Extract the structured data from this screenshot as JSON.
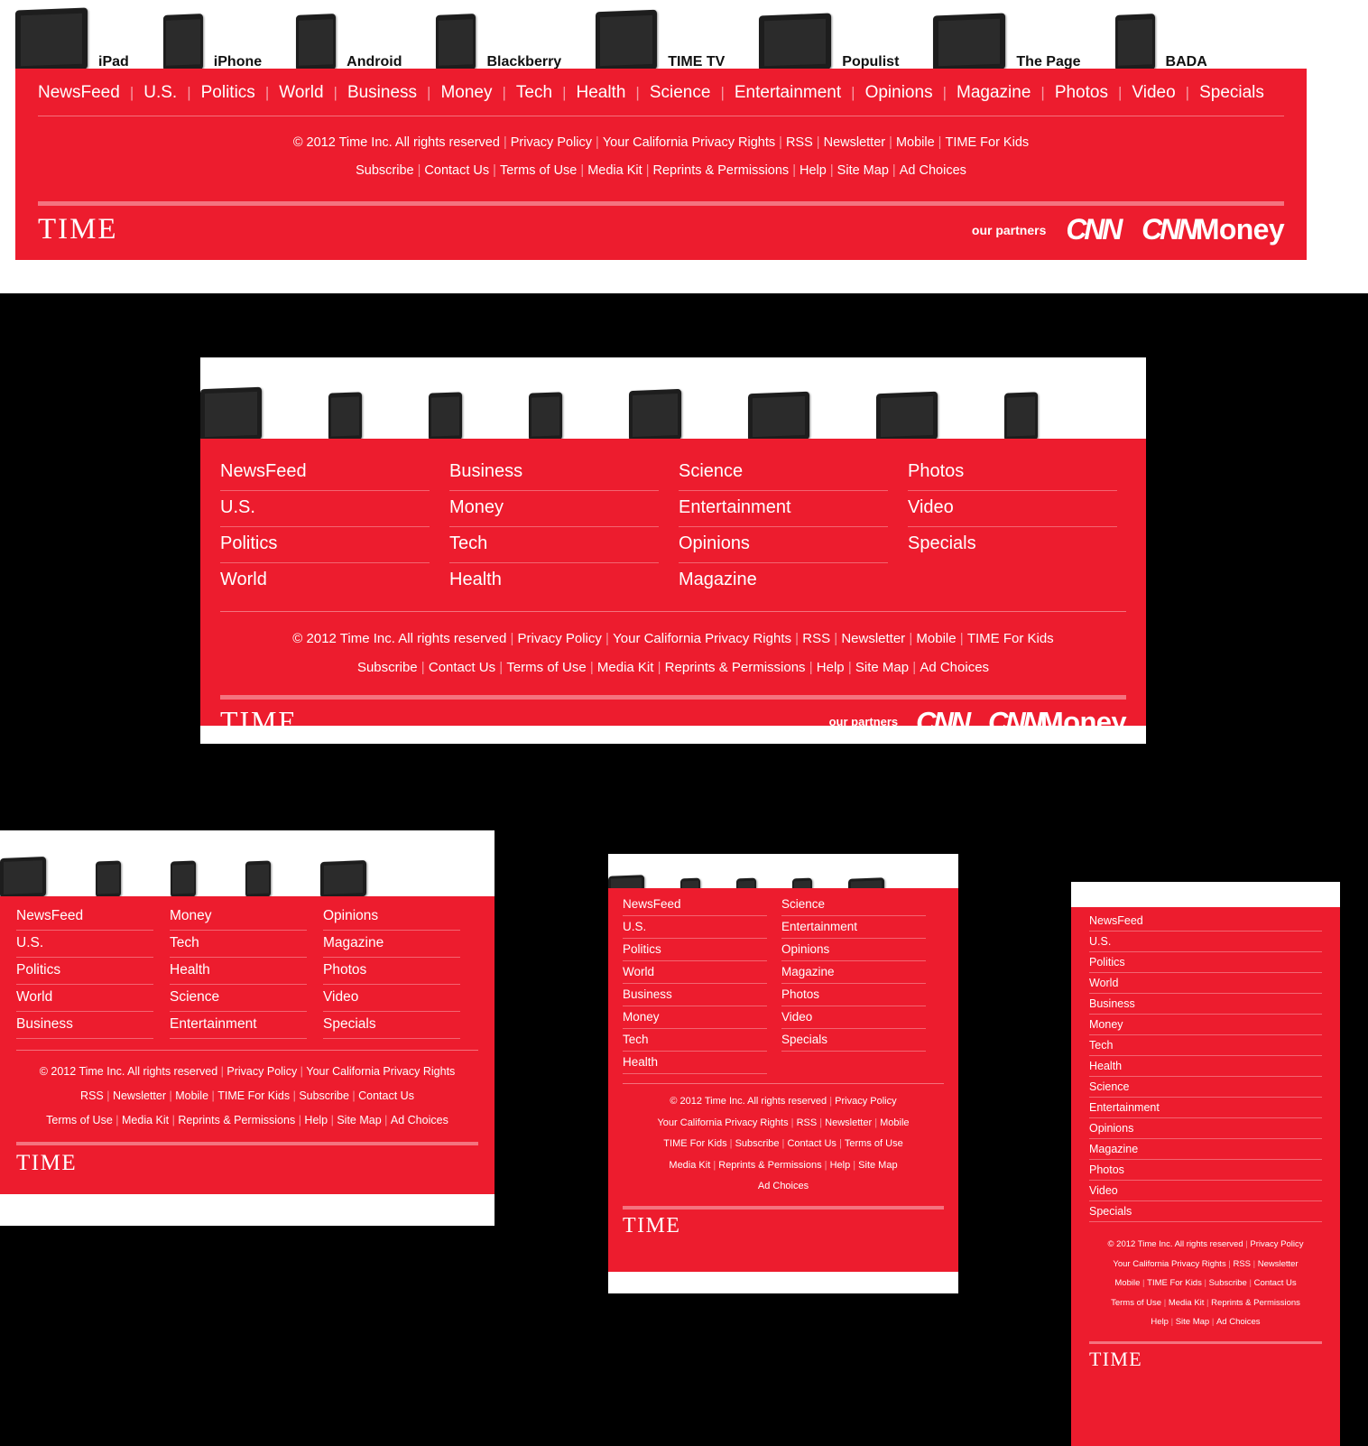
{
  "brand": {
    "logo_text": "TIME",
    "our_partners_label": "our partners",
    "partners": [
      {
        "name": "cnn-logo",
        "text": "CNN"
      },
      {
        "name": "cnnmoney-logo",
        "text_mark": "CNN",
        "text_word": "Money"
      }
    ]
  },
  "colors": {
    "brand_red": "#ED1C2E",
    "rule_pink": "#F4737F",
    "separator": "#F59AA2",
    "page_background": "#000000",
    "panel_background": "#FFFFFF"
  },
  "devices": [
    {
      "label": "iPad",
      "icon": "tablet-ipad-icon"
    },
    {
      "label": "iPhone",
      "icon": "phone-iphone-icon"
    },
    {
      "label": "Android",
      "icon": "phone-android-icon"
    },
    {
      "label": "Blackberry",
      "icon": "phone-blackberry-icon"
    },
    {
      "label": "TIME TV",
      "icon": "tablet-timetv-icon"
    },
    {
      "label": "Populist",
      "icon": "tablet-populist-icon"
    },
    {
      "label": "The Page",
      "icon": "tablet-thepage-icon"
    },
    {
      "label": "BADA",
      "icon": "phone-bada-icon"
    }
  ],
  "sections": [
    "NewsFeed",
    "U.S.",
    "Politics",
    "World",
    "Business",
    "Money",
    "Tech",
    "Health",
    "Science",
    "Entertainment",
    "Opinions",
    "Magazine",
    "Photos",
    "Video",
    "Specials"
  ],
  "legal": {
    "copyright": "© 2012 Time Inc. All rights reserved",
    "links": [
      "Privacy Policy",
      "Your California Privacy Rights",
      "RSS",
      "Newsletter",
      "Mobile",
      "TIME For Kids",
      "Subscribe",
      "Contact Us",
      "Terms of Use",
      "Media Kit",
      "Reprints & Permissions",
      "Help",
      "Site Map",
      "Ad Choices"
    ],
    "separator": "|"
  },
  "panels": [
    {
      "name": "desktop-footer",
      "width_label": "full",
      "nav_layout": "single-row",
      "nav_items": [
        "NewsFeed",
        "U.S.",
        "Politics",
        "World",
        "Business",
        "Money",
        "Tech",
        "Health",
        "Science",
        "Entertainment",
        "Opinions",
        "Magazine",
        "Photos",
        "Video",
        "Specials"
      ],
      "devices_shown": [
        "iPad",
        "iPhone",
        "Android",
        "Blackberry",
        "TIME TV",
        "Populist",
        "The Page",
        "BADA"
      ],
      "legal_rows": [
        [
          "© 2012 Time Inc. All rights reserved",
          "Privacy Policy",
          "Your California Privacy Rights",
          "RSS",
          "Newsletter",
          "Mobile",
          "TIME For Kids"
        ],
        [
          "Subscribe",
          "Contact Us",
          "Terms of Use",
          "Media Kit",
          "Reprints & Permissions",
          "Help",
          "Site Map",
          "Ad Choices"
        ]
      ],
      "show_partners": true
    },
    {
      "name": "tablet-landscape-footer",
      "nav_layout": "four-column",
      "columns": [
        [
          "NewsFeed",
          "U.S.",
          "Politics",
          "World"
        ],
        [
          "Business",
          "Money",
          "Tech",
          "Health"
        ],
        [
          "Science",
          "Entertainment",
          "Opinions",
          "Magazine"
        ],
        [
          "Photos",
          "Video",
          "Specials"
        ]
      ],
      "devices_shown": [
        "iPad",
        "iPhone",
        "Android",
        "Blackberry",
        "TIME TV",
        "Populist",
        "The Page",
        "BADA"
      ],
      "legal_rows": [
        [
          "© 2012 Time Inc. All rights reserved",
          "Privacy Policy",
          "Your California Privacy Rights",
          "RSS",
          "Newsletter",
          "Mobile",
          "TIME For Kids"
        ],
        [
          "Subscribe",
          "Contact Us",
          "Terms of Use",
          "Media Kit",
          "Reprints & Permissions",
          "Help",
          "Site Map",
          "Ad Choices"
        ]
      ],
      "show_partners": true
    },
    {
      "name": "tablet-portrait-footer",
      "nav_layout": "three-column",
      "columns": [
        [
          "NewsFeed",
          "U.S.",
          "Politics",
          "World",
          "Business"
        ],
        [
          "Money",
          "Tech",
          "Health",
          "Science",
          "Entertainment"
        ],
        [
          "Opinions",
          "Magazine",
          "Photos",
          "Video",
          "Specials"
        ]
      ],
      "devices_shown": [
        "iPad",
        "iPhone",
        "Android",
        "Blackberry",
        "Populist"
      ],
      "legal_rows": [
        [
          "© 2012 Time Inc. All rights reserved",
          "Privacy Policy",
          "Your California Privacy Rights"
        ],
        [
          "RSS",
          "Newsletter",
          "Mobile",
          "TIME For Kids",
          "Subscribe",
          "Contact Us"
        ],
        [
          "Terms of Use",
          "Media Kit",
          "Reprints & Permissions",
          "Help",
          "Site Map",
          "Ad Choices"
        ]
      ],
      "show_partners": false
    },
    {
      "name": "phone-large-footer",
      "nav_layout": "two-column",
      "columns": [
        [
          "NewsFeed",
          "U.S.",
          "Politics",
          "World",
          "Business",
          "Money",
          "Tech",
          "Health"
        ],
        [
          "Science",
          "Entertainment",
          "Opinions",
          "Magazine",
          "Photos",
          "Video",
          "Specials"
        ]
      ],
      "devices_shown": [
        "iPad",
        "iPhone",
        "Android",
        "Blackberry",
        "Populist"
      ],
      "legal_rows": [
        [
          "© 2012 Time Inc. All rights reserved",
          "Privacy Policy"
        ],
        [
          "Your California Privacy Rights",
          "RSS",
          "Newsletter",
          "Mobile"
        ],
        [
          "TIME For Kids",
          "Subscribe",
          "Contact Us",
          "Terms of Use"
        ],
        [
          "Media Kit",
          "Reprints & Permissions",
          "Help",
          "Site Map"
        ],
        [
          "Ad Choices"
        ]
      ],
      "show_partners": false
    },
    {
      "name": "phone-small-footer",
      "nav_layout": "one-column",
      "columns": [
        [
          "NewsFeed",
          "U.S.",
          "Politics",
          "World",
          "Business",
          "Money",
          "Tech",
          "Health",
          "Science",
          "Entertainment",
          "Opinions",
          "Magazine",
          "Photos",
          "Video",
          "Specials"
        ]
      ],
      "devices_shown": [],
      "legal_rows": [
        [
          "© 2012 Time Inc. All rights reserved",
          "Privacy Policy"
        ],
        [
          "Your California Privacy Rights",
          "RSS",
          "Newsletter"
        ],
        [
          "Mobile",
          "TIME For Kids",
          "Subscribe",
          "Contact Us"
        ],
        [
          "Terms of Use",
          "Media Kit",
          "Reprints & Permissions"
        ],
        [
          "Help",
          "Site Map",
          "Ad Choices"
        ]
      ],
      "show_partners": false
    }
  ]
}
